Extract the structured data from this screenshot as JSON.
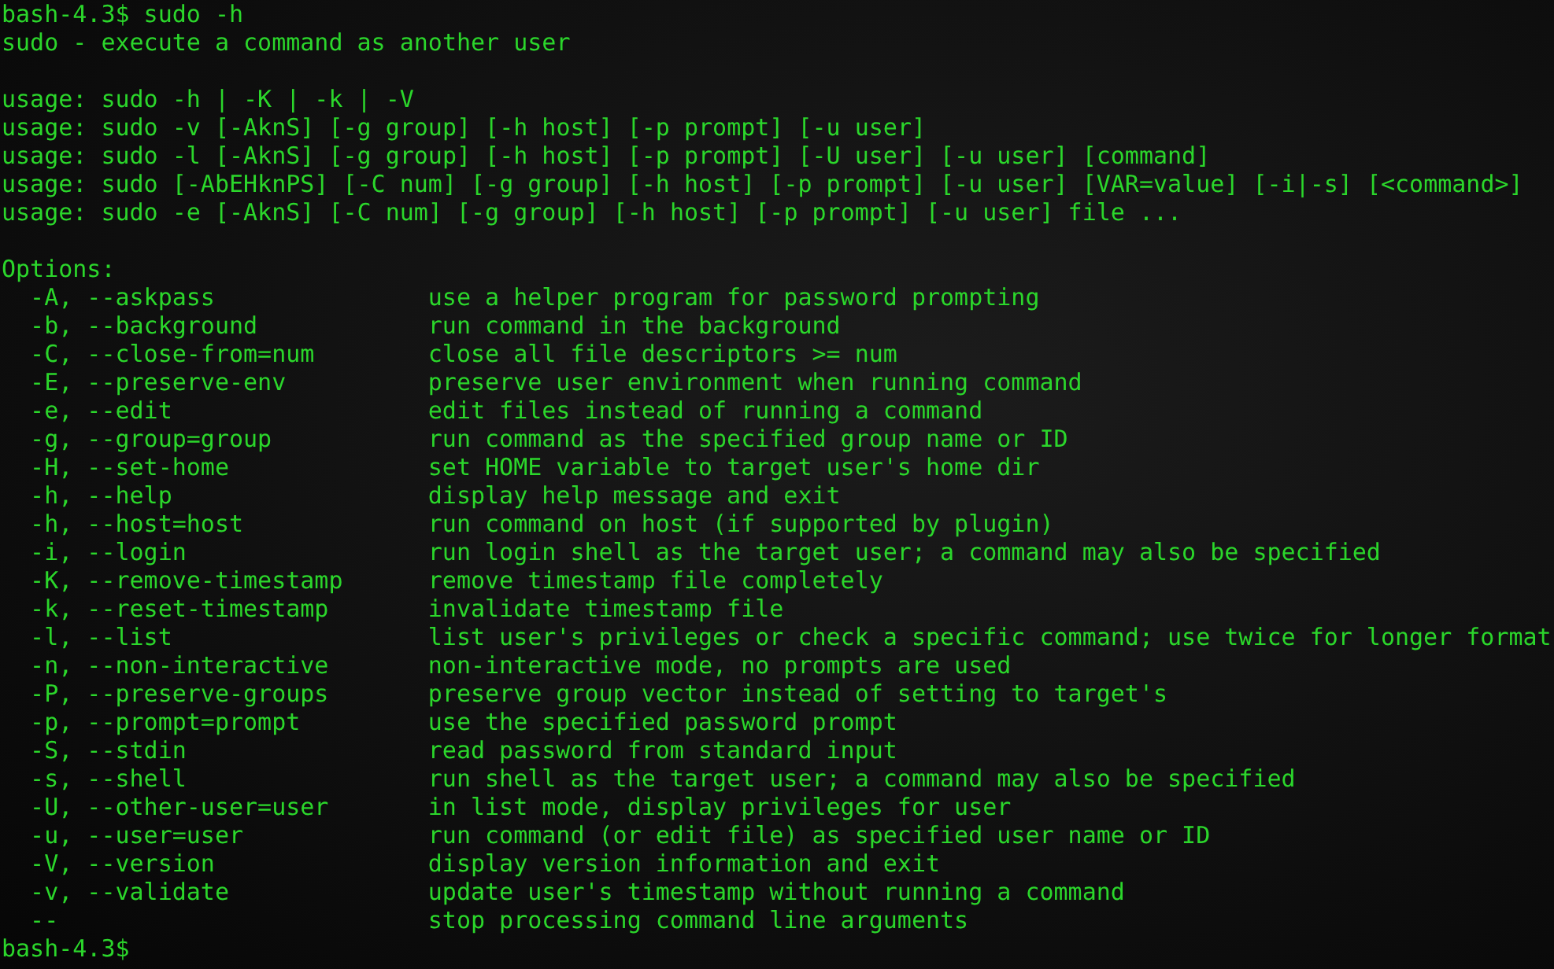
{
  "terminal": {
    "lines": [
      {
        "kind": "text",
        "text": "bash-4.3$ sudo -h"
      },
      {
        "kind": "text",
        "text": "sudo - execute a command as another user"
      },
      {
        "kind": "blank"
      },
      {
        "kind": "text",
        "text": "usage: sudo -h | -K | -k | -V"
      },
      {
        "kind": "text",
        "text": "usage: sudo -v [-AknS] [-g group] [-h host] [-p prompt] [-u user]"
      },
      {
        "kind": "text",
        "text": "usage: sudo -l [-AknS] [-g group] [-h host] [-p prompt] [-U user] [-u user] [command]"
      },
      {
        "kind": "text",
        "text": "usage: sudo [-AbEHknPS] [-C num] [-g group] [-h host] [-p prompt] [-u user] [VAR=value] [-i|-s] [<command>]"
      },
      {
        "kind": "text",
        "text": "usage: sudo -e [-AknS] [-C num] [-g group] [-h host] [-p prompt] [-u user] file ..."
      },
      {
        "kind": "blank"
      },
      {
        "kind": "text",
        "text": "Options:"
      },
      {
        "kind": "option",
        "flag": "-A, --askpass",
        "description": "use a helper program for password prompting"
      },
      {
        "kind": "option",
        "flag": "-b, --background",
        "description": "run command in the background"
      },
      {
        "kind": "option",
        "flag": "-C, --close-from=num",
        "description": "close all file descriptors >= num"
      },
      {
        "kind": "option",
        "flag": "-E, --preserve-env",
        "description": "preserve user environment when running command"
      },
      {
        "kind": "option",
        "flag": "-e, --edit",
        "description": "edit files instead of running a command"
      },
      {
        "kind": "option",
        "flag": "-g, --group=group",
        "description": "run command as the specified group name or ID"
      },
      {
        "kind": "option",
        "flag": "-H, --set-home",
        "description": "set HOME variable to target user's home dir"
      },
      {
        "kind": "option",
        "flag": "-h, --help",
        "description": "display help message and exit"
      },
      {
        "kind": "option",
        "flag": "-h, --host=host",
        "description": "run command on host (if supported by plugin)"
      },
      {
        "kind": "option",
        "flag": "-i, --login",
        "description": "run login shell as the target user; a command may also be specified"
      },
      {
        "kind": "option",
        "flag": "-K, --remove-timestamp",
        "description": "remove timestamp file completely"
      },
      {
        "kind": "option",
        "flag": "-k, --reset-timestamp",
        "description": "invalidate timestamp file"
      },
      {
        "kind": "option",
        "flag": "-l, --list",
        "description": "list user's privileges or check a specific command; use twice for longer format"
      },
      {
        "kind": "option",
        "flag": "-n, --non-interactive",
        "description": "non-interactive mode, no prompts are used"
      },
      {
        "kind": "option",
        "flag": "-P, --preserve-groups",
        "description": "preserve group vector instead of setting to target's"
      },
      {
        "kind": "option",
        "flag": "-p, --prompt=prompt",
        "description": "use the specified password prompt"
      },
      {
        "kind": "option",
        "flag": "-S, --stdin",
        "description": "read password from standard input"
      },
      {
        "kind": "option",
        "flag": "-s, --shell",
        "description": "run shell as the target user; a command may also be specified"
      },
      {
        "kind": "option",
        "flag": "-U, --other-user=user",
        "description": "in list mode, display privileges for user"
      },
      {
        "kind": "option",
        "flag": "-u, --user=user",
        "description": "run command (or edit file) as specified user name or ID"
      },
      {
        "kind": "option",
        "flag": "-V, --version",
        "description": "display version information and exit"
      },
      {
        "kind": "option",
        "flag": "-v, --validate",
        "description": "update user's timestamp without running a command"
      },
      {
        "kind": "option",
        "flag": "--",
        "description": "stop processing command line arguments"
      },
      {
        "kind": "text",
        "text": "bash-4.3$"
      }
    ]
  }
}
